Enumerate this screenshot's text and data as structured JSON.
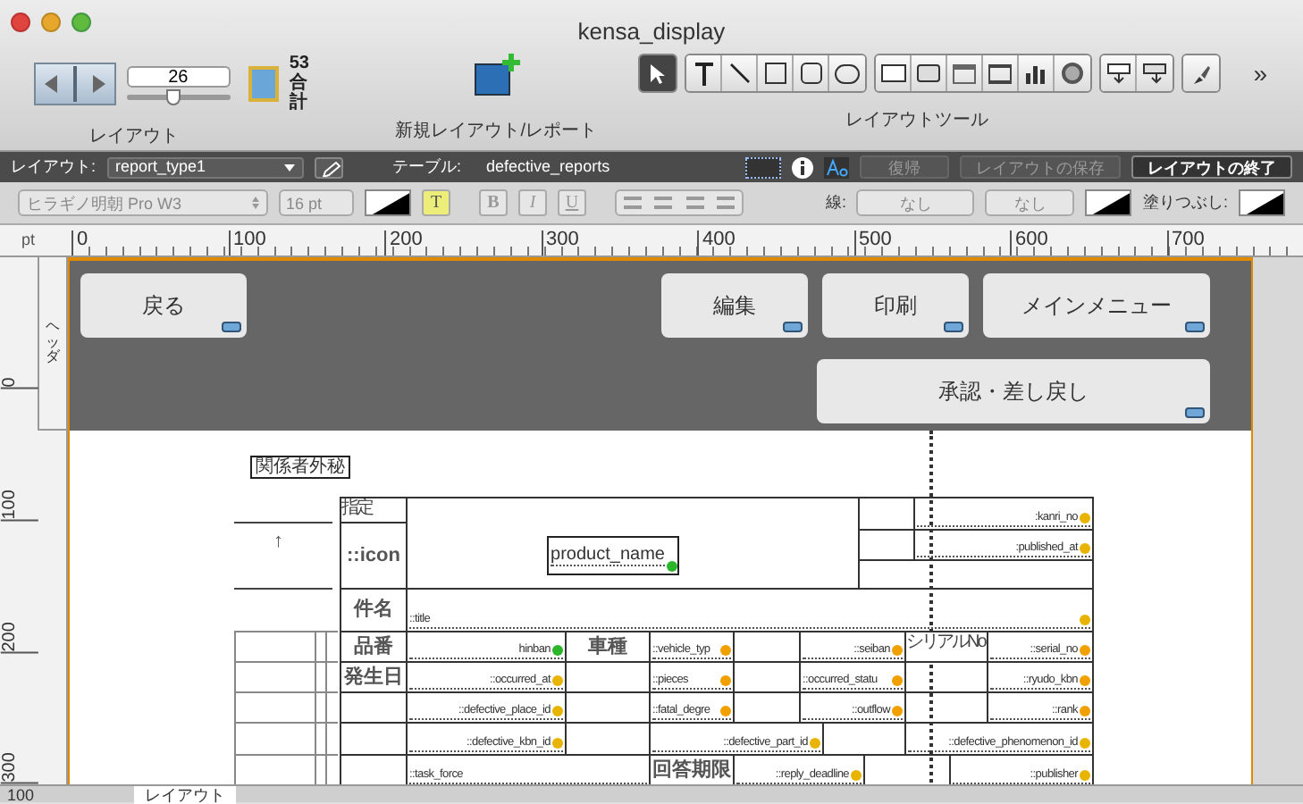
{
  "window": {
    "title": "kensa_display"
  },
  "toolbar": {
    "record": "26",
    "slider": {
      "level": 0.45
    },
    "total": "53",
    "total_label": "合計",
    "layout_label": "レイアウト",
    "new_layout_label": "新規レイアウト/レポート",
    "tools_label": "レイアウトツール",
    "overflow": "»",
    "tools": [
      {
        "kind": "pointer",
        "selected": true
      },
      {
        "kind": "text",
        "selected": false
      },
      {
        "kind": "line",
        "selected": false
      },
      {
        "kind": "rectangle",
        "selected": false
      },
      {
        "kind": "rounded",
        "selected": false
      },
      {
        "kind": "oval",
        "selected": false
      },
      {
        "kind": "field",
        "selected": false
      },
      {
        "kind": "button",
        "selected": false
      },
      {
        "kind": "tab",
        "selected": false
      },
      {
        "kind": "portal",
        "selected": false
      },
      {
        "kind": "chart",
        "selected": false
      },
      {
        "kind": "web",
        "selected": false
      },
      {
        "kind": "fieldpicker",
        "selected": false
      },
      {
        "kind": "part",
        "selected": false
      },
      {
        "kind": "painter",
        "selected": false
      }
    ]
  },
  "layout_bar": {
    "layout_label": "レイアウト:",
    "layout": "report_type1",
    "table_label": "テーブル:",
    "table": "defective_reports",
    "buttons": [
      {
        "label": "復帰",
        "disabled": true
      },
      {
        "label": "レイアウトの保存",
        "disabled": true
      },
      {
        "label": "レイアウトの終了",
        "disabled": false
      }
    ]
  },
  "format_bar": {
    "font": "ヒラギノ明朝 Pro W3",
    "size": "16 pt",
    "styles": [
      {
        "label": "T",
        "selected": true
      },
      {
        "label": "B",
        "selected": false
      },
      {
        "label": "I",
        "selected": false
      },
      {
        "label": "U",
        "selected": false
      }
    ],
    "line_label": "線:",
    "line_style": "なし",
    "line_width": "なし",
    "fill_label": "塗りつぶし:"
  },
  "ruler": {
    "unit": "pt",
    "ticks": [
      "0",
      "100",
      "200",
      "300",
      "400",
      "500",
      "600",
      "700"
    ]
  },
  "vertical_ruler": {
    "ticks": [
      "0",
      "100",
      "200",
      "300"
    ],
    "part_label": "ヘッダ"
  },
  "header_buttons": [
    {
      "label": "戻る"
    },
    {
      "label": "編集"
    },
    {
      "label": "印刷"
    },
    {
      "label": "メインメニュー"
    },
    {
      "label": "承認・差し戻し"
    }
  ],
  "body": {
    "confidential_label": "関係者外秘",
    "arrow": "↑",
    "cells": [
      {
        "kind": "note",
        "text": "指定"
      },
      {
        "kind": "label",
        "text": "::icon"
      },
      {
        "kind": "empty"
      },
      {
        "kind": "box",
        "text": "product_name",
        "color": "#2bb52b"
      },
      {
        "kind": "empty"
      },
      {
        "kind": "empty"
      },
      {
        "kind": "field",
        "text": ":kanri_no",
        "color": "#e8b400"
      },
      {
        "kind": "empty"
      },
      {
        "kind": "field",
        "text": ":published_at",
        "color": "#e8b400"
      },
      {
        "kind": "label",
        "text": "件名"
      },
      {
        "kind": "field",
        "text": "::title",
        "color": "#e8b400"
      },
      {
        "kind": "label",
        "text": "品番"
      },
      {
        "kind": "field",
        "text": "hinban",
        "color": "#2bb52b"
      },
      {
        "kind": "label",
        "text": "車種"
      },
      {
        "kind": "field",
        "text": "::vehicle_typ",
        "color": "#f0a000"
      },
      {
        "kind": "empty"
      },
      {
        "kind": "field",
        "text": "::seiban",
        "color": "#f0a000"
      },
      {
        "kind": "note",
        "text": "シリアルNo"
      },
      {
        "kind": "field",
        "text": "::serial_no",
        "color": "#f0a000"
      },
      {
        "kind": "label",
        "text": "発生日"
      },
      {
        "kind": "field",
        "text": "::occurred_at",
        "color": "#e8b400"
      },
      {
        "kind": "empty"
      },
      {
        "kind": "field",
        "text": "::pieces",
        "color": "#f0a000"
      },
      {
        "kind": "empty"
      },
      {
        "kind": "field",
        "text": "::occurred_statu",
        "color": "#f0a000"
      },
      {
        "kind": "empty"
      },
      {
        "kind": "field",
        "text": "::ryudo_kbn",
        "color": "#f0a000"
      },
      {
        "kind": "empty"
      },
      {
        "kind": "field",
        "text": "::defective_place_id",
        "color": "#e8b400"
      },
      {
        "kind": "empty"
      },
      {
        "kind": "field",
        "text": "::fatal_degre",
        "color": "#f0a000"
      },
      {
        "kind": "empty"
      },
      {
        "kind": "field",
        "text": "::outflow",
        "color": "#f0a000"
      },
      {
        "kind": "empty"
      },
      {
        "kind": "field",
        "text": "::rank",
        "color": "#f0a000"
      },
      {
        "kind": "empty"
      },
      {
        "kind": "field",
        "text": "::defective_kbn_id",
        "color": "#e8b400"
      },
      {
        "kind": "empty"
      },
      {
        "kind": "field",
        "text": "::defective_part_id",
        "color": "#e8b400"
      },
      {
        "kind": "empty"
      },
      {
        "kind": "field",
        "text": "::defective_phenomenon_id",
        "color": "#e8b400"
      },
      {
        "kind": "empty"
      },
      {
        "kind": "field",
        "text": "::task_force"
      },
      {
        "kind": "label",
        "text": "回答期限"
      },
      {
        "kind": "field",
        "text": "::reply_deadline",
        "color": "#e8b400"
      },
      {
        "kind": "empty"
      },
      {
        "kind": "field",
        "text": "::publisher",
        "color": "#e8b400"
      }
    ]
  },
  "status_bar": {
    "zoom": "100",
    "mode": "レイアウト"
  }
}
